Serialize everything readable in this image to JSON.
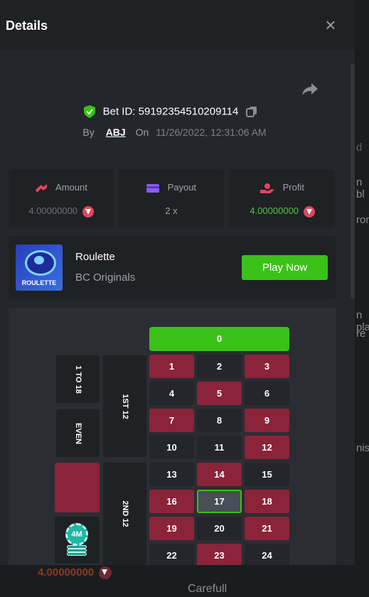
{
  "modal": {
    "title": "Details",
    "close_icon": "×"
  },
  "bet": {
    "id_label": "Bet ID: 59192354510209114",
    "by_label": "By",
    "user": "ABJ",
    "on_label": "On",
    "datetime": "11/26/2022, 12:31:06 AM"
  },
  "stats": {
    "amount": {
      "label": "Amount",
      "value_dim": "4.",
      "value_main": "00000000",
      "icon": "amount-icon",
      "color": "#e2455e"
    },
    "payout": {
      "label": "Payout",
      "value": "2 x",
      "icon": "wallet-icon",
      "color": "#8b5cf6"
    },
    "profit": {
      "label": "Profit",
      "value_green": "4.",
      "value_main": "00000000",
      "icon": "profit-hand-icon",
      "color": "#e2455e"
    }
  },
  "game": {
    "thumb_text": "ROULETTE",
    "name": "Roulette",
    "provider": "BC Originals",
    "play_label": "Play Now"
  },
  "board": {
    "zero": "0",
    "side": [
      "1 TO 18",
      "EVEN"
    ],
    "dozens": [
      "1ST 12",
      "2ND 12"
    ],
    "chip_label": "4M",
    "selected": "17",
    "rows": [
      [
        {
          "n": "1",
          "c": "red"
        },
        {
          "n": "2",
          "c": "black"
        },
        {
          "n": "3",
          "c": "red"
        }
      ],
      [
        {
          "n": "4",
          "c": "black"
        },
        {
          "n": "5",
          "c": "red"
        },
        {
          "n": "6",
          "c": "black"
        }
      ],
      [
        {
          "n": "7",
          "c": "red"
        },
        {
          "n": "8",
          "c": "black"
        },
        {
          "n": "9",
          "c": "red"
        }
      ],
      [
        {
          "n": "10",
          "c": "black"
        },
        {
          "n": "11",
          "c": "black"
        },
        {
          "n": "12",
          "c": "red"
        }
      ],
      [
        {
          "n": "13",
          "c": "black"
        },
        {
          "n": "14",
          "c": "red"
        },
        {
          "n": "15",
          "c": "black"
        }
      ],
      [
        {
          "n": "16",
          "c": "red"
        },
        {
          "n": "17",
          "c": "black"
        },
        {
          "n": "18",
          "c": "red"
        }
      ],
      [
        {
          "n": "19",
          "c": "red"
        },
        {
          "n": "20",
          "c": "black"
        },
        {
          "n": "21",
          "c": "red"
        }
      ],
      [
        {
          "n": "22",
          "c": "black"
        },
        {
          "n": "23",
          "c": "red"
        },
        {
          "n": "24",
          "c": "black"
        }
      ]
    ]
  },
  "background": {
    "fragments": [
      "d",
      "n bl",
      "ron",
      "n pla",
      "re",
      "nis"
    ],
    "bottom_amount": "4.00000000",
    "bottom_text": "Carefull"
  },
  "colors": {
    "accent_green": "#3bc117",
    "roulette_red": "#8b2339",
    "panel": "#24262b"
  }
}
